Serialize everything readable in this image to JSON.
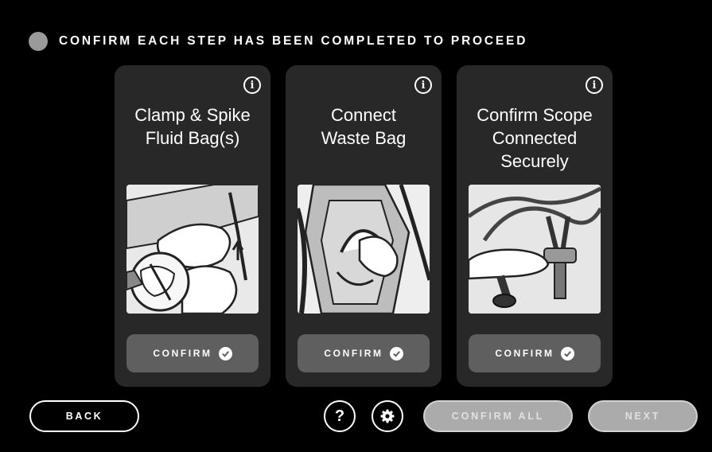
{
  "header": {
    "text": "CONFIRM EACH STEP HAS BEEN COMPLETED TO PROCEED"
  },
  "steps": [
    {
      "title": "Clamp & Spike\nFluid Bag(s)",
      "info_icon": "info-icon",
      "confirm_label": "CONFIRM"
    },
    {
      "title": "Connect\nWaste Bag",
      "info_icon": "info-icon",
      "confirm_label": "CONFIRM"
    },
    {
      "title": "Confirm Scope\nConnected\nSecurely",
      "info_icon": "info-icon",
      "confirm_label": "CONFIRM"
    }
  ],
  "footer": {
    "back_label": "BACK",
    "help_label": "?",
    "confirm_all_label": "CONFIRM ALL",
    "next_label": "NEXT"
  },
  "colors": {
    "background": "#000000",
    "card": "#282828",
    "confirm_button": "#5f5f5f",
    "disabled_button": "#ababab",
    "status_dot": "#9a9a9a"
  }
}
